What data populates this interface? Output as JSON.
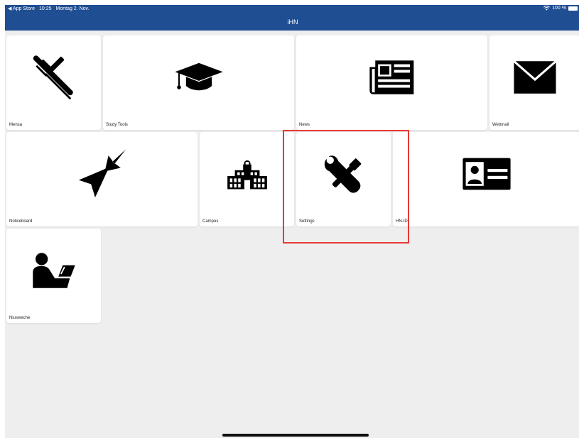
{
  "status_bar": {
    "back_app": "◀ App Store",
    "time": "10:25",
    "date": "Montag 2. Nov.",
    "wifi": "wifi-icon",
    "battery": "100 %"
  },
  "app_title": "iHN",
  "tiles": [
    {
      "id": "mensa",
      "label": "Mensa",
      "icon": "cutlery-icon"
    },
    {
      "id": "study-tools",
      "label": "Study Tools",
      "icon": "graduation-cap-icon"
    },
    {
      "id": "news",
      "label": "News",
      "icon": "newspaper-icon"
    },
    {
      "id": "webmail",
      "label": "Webmail",
      "icon": "envelope-icon"
    },
    {
      "id": "noticeboard",
      "label": "Noticeboard",
      "icon": "pin-icon"
    },
    {
      "id": "campus",
      "label": "Campus",
      "icon": "school-building-icon"
    },
    {
      "id": "settings",
      "label": "Settings",
      "icon": "tools-icon"
    },
    {
      "id": "hn-id",
      "label": "HN-ID",
      "icon": "id-card-icon"
    },
    {
      "id": "niusweche",
      "label": "Niusweche",
      "icon": "reader-icon"
    }
  ],
  "colors": {
    "header_bg": "#1f4e92",
    "page_bg": "#eeeeee",
    "tile_bg": "#ffffff",
    "highlight": "#e53935"
  }
}
